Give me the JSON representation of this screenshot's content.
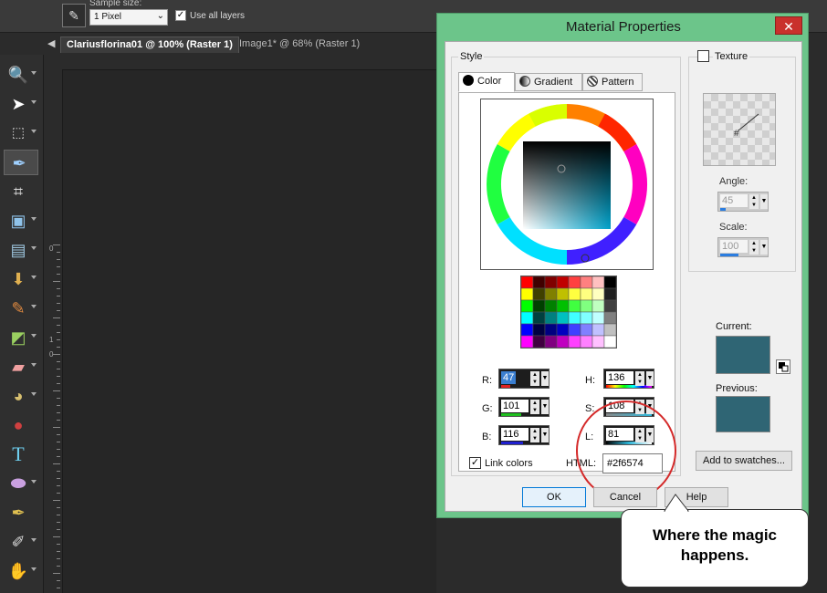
{
  "topbar": {
    "sample_size_label": "Sample size:",
    "sample_size_value": "1 Pixel",
    "use_all_layers_label": "Use all layers",
    "use_all_layers_checked": true
  },
  "tabs": [
    {
      "label": "Clariusflorina01 @ 100% (Raster 1)",
      "active": true
    },
    {
      "label": "Image1* @  68% (Raster 1)",
      "active": false
    }
  ],
  "toolbar": {
    "tools": [
      "zoom-tool",
      "pick-tool",
      "selection-tool",
      "dropper-tool",
      "crop-tool",
      "makeover-tool",
      "straighten-tool",
      "fill-tool",
      "paint-brush-tool",
      "clone-tool",
      "eraser-tool",
      "smudge-tool",
      "red-eye-tool",
      "text-tool",
      "shape-tool",
      "pen-tool",
      "warp-brush-tool",
      "hand-tool"
    ]
  },
  "ruler": {
    "labels": [
      "0",
      "1",
      "0"
    ]
  },
  "dialog": {
    "title": "Material Properties",
    "close_symbol": "✕",
    "style_label": "Style",
    "tabs": {
      "color": "Color",
      "gradient": "Gradient",
      "pattern": "Pattern"
    },
    "rgb": {
      "r_label": "R:",
      "r_value": "47",
      "g_label": "G:",
      "g_value": "101",
      "b_label": "B:",
      "b_value": "116"
    },
    "hsl": {
      "h_label": "H:",
      "h_value": "136",
      "s_label": "S:",
      "s_value": "108",
      "l_label": "L:",
      "l_value": "81"
    },
    "link_colors_label": "Link colors",
    "link_colors_checked": true,
    "html_label": "HTML:",
    "html_value": "#2f6574",
    "texture_label": "Texture",
    "angle_label": "Angle:",
    "angle_value": "45",
    "scale_label": "Scale:",
    "scale_value": "100",
    "current_label": "Current:",
    "previous_label": "Previous:",
    "current_color": "#2f6574",
    "previous_color": "#2f6574",
    "add_swatches_label": "Add to swatches...",
    "ok_label": "OK",
    "cancel_label": "Cancel",
    "help_label": "Help"
  },
  "callout": {
    "line1": "Where the magic",
    "line2": "happens."
  },
  "colors": {
    "accent_green": "#6cc58a",
    "highlight_circle": "#d42a2a",
    "selected_value_bg": "#3b7fd1"
  }
}
